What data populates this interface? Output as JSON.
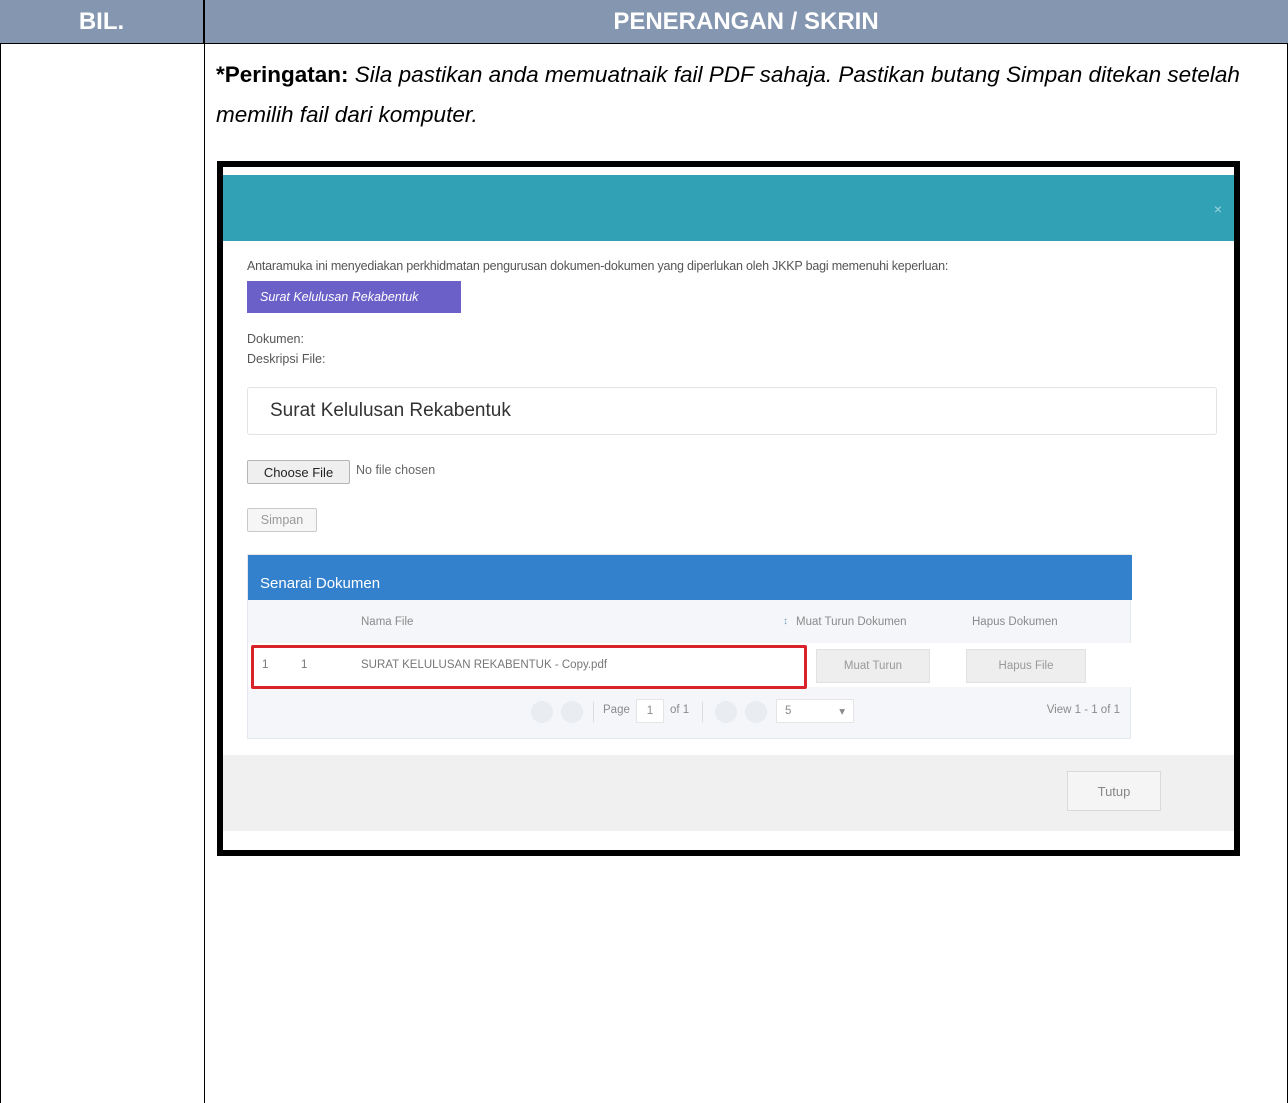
{
  "table": {
    "col_bil": "BIL.",
    "col_penerangan": "PENERANGAN / SKRIN"
  },
  "warning": {
    "label": "*Peringatan:",
    "text": "Sila pastikan anda memuatnaik fail PDF sahaja. Pastikan butang Simpan ditekan setelah memilih fail dari komputer."
  },
  "modal": {
    "close_icon": "×",
    "intro": "Antaramuka ini menyediakan perkhidmatan pengurusan dokumen-dokumen yang diperlukan oleh JKKP bagi memenuhi keperluan:",
    "doc_type_button": "Surat Kelulusan Rekabentuk",
    "label_dokumen": "Dokumen:",
    "label_deskripsi": "Deskripsi File:",
    "deskripsi_value": "Surat Kelulusan Rekabentuk",
    "choose_file_button": "Choose File",
    "file_status": "No file chosen",
    "save_button": "Simpan",
    "close_button": "Tutup"
  },
  "grid": {
    "title": "Senarai Dokumen",
    "columns": {
      "name": "Nama File",
      "sort_icon": "↕",
      "download": "Muat Turun Dokumen",
      "delete": "Hapus Dokumen"
    },
    "rows": [
      {
        "rownum": "1",
        "no": "1",
        "name": "SURAT KELULUSAN REKABENTUK - Copy.pdf",
        "download_button": "Muat Turun",
        "delete_button": "Hapus File"
      }
    ],
    "pager": {
      "page_label": "Page",
      "page_value": "1",
      "of_label": "of 1",
      "page_size": "5",
      "dropdown_icon": "▾",
      "view_text": "View 1 - 1 of 1"
    }
  },
  "colors": {
    "header_bg": "#8496b0",
    "modal_header": "#31a2b5",
    "type_button": "#6b5fc8",
    "grid_title": "#3381cc",
    "highlight": "#d9232b"
  }
}
